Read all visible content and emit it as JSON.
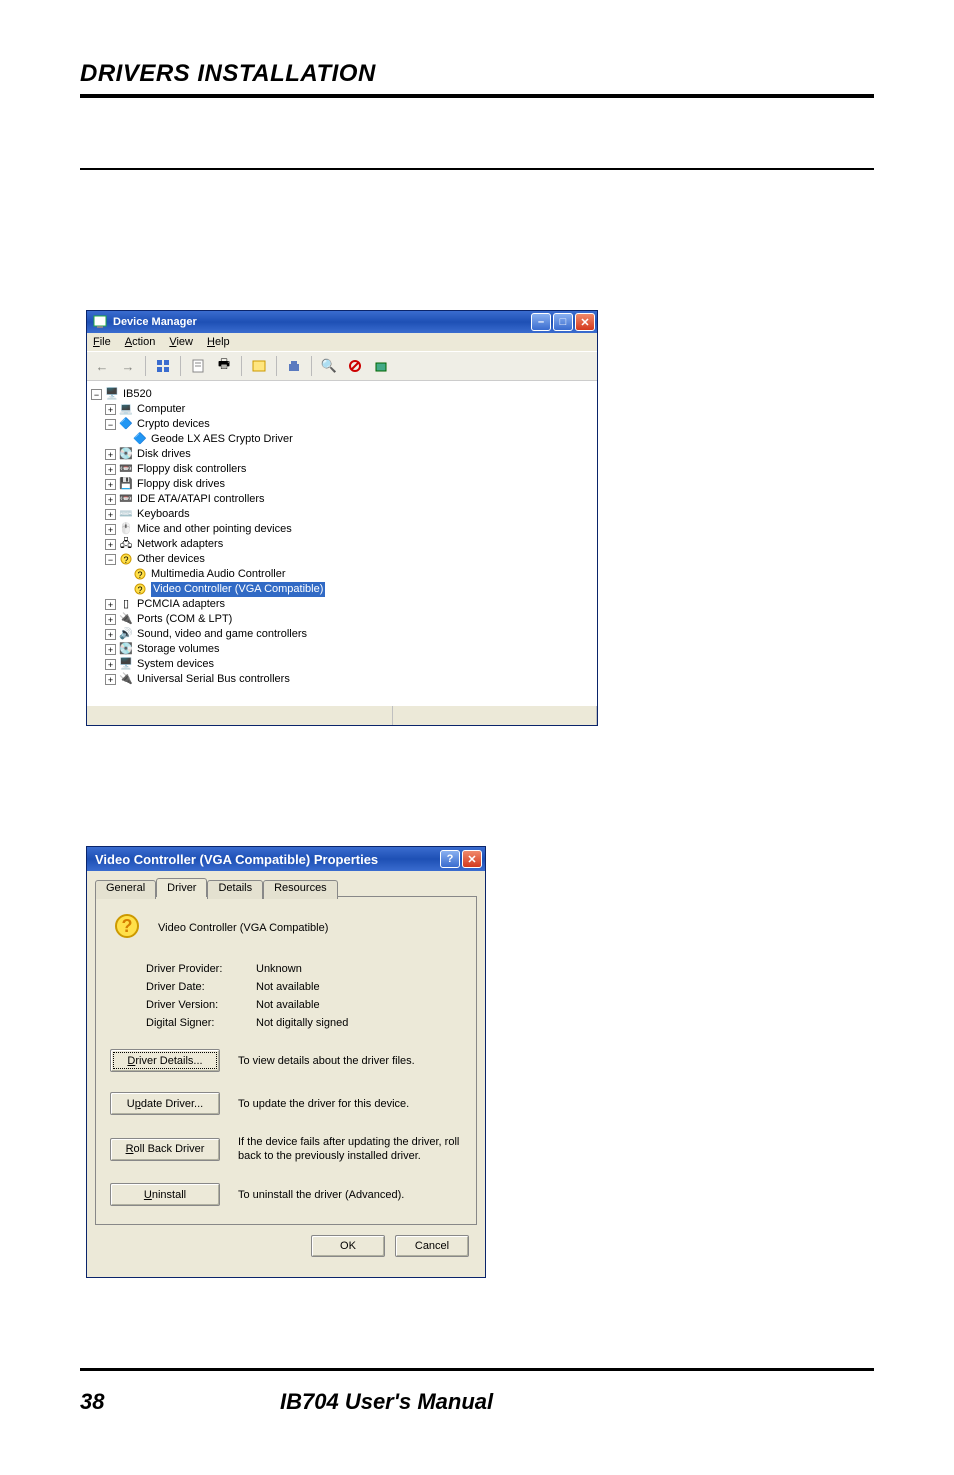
{
  "page": {
    "header": "DRIVERS INSTALLATION",
    "number": "38",
    "footer": "IB704 User's Manual"
  },
  "dm": {
    "title": "Device Manager",
    "menu": {
      "file": "File",
      "action": "Action",
      "view": "View",
      "help": "Help"
    },
    "root": "IB520",
    "nodes": {
      "computer": "Computer",
      "crypto": "Crypto devices",
      "crypto_child": "Geode LX AES Crypto Driver",
      "disk": "Disk drives",
      "floppy_ctrl": "Floppy disk controllers",
      "floppy": "Floppy disk drives",
      "ide": "IDE ATA/ATAPI controllers",
      "keyboards": "Keyboards",
      "mice": "Mice and other pointing devices",
      "network": "Network adapters",
      "other": "Other devices",
      "other_audio": "Multimedia Audio Controller",
      "other_video": "Video Controller (VGA Compatible)",
      "pcmcia": "PCMCIA adapters",
      "ports": "Ports (COM & LPT)",
      "sound": "Sound, video and game controllers",
      "storage": "Storage volumes",
      "system": "System devices",
      "usb": "Universal Serial Bus controllers"
    }
  },
  "prop": {
    "title": "Video Controller (VGA Compatible) Properties",
    "tabs": {
      "general": "General",
      "driver": "Driver",
      "details": "Details",
      "resources": "Resources"
    },
    "device_name": "Video Controller (VGA Compatible)",
    "rows": {
      "provider_l": "Driver Provider:",
      "provider_v": "Unknown",
      "date_l": "Driver Date:",
      "date_v": "Not available",
      "version_l": "Driver Version:",
      "version_v": "Not available",
      "signer_l": "Digital Signer:",
      "signer_v": "Not digitally signed"
    },
    "btns": {
      "details": "Driver Details...",
      "details_d": "To view details about the driver files.",
      "update": "Update Driver...",
      "update_d": "To update the driver for this device.",
      "rollback": "Roll Back Driver",
      "rollback_d": "If the device fails after updating the driver, roll back to the previously installed driver.",
      "uninstall": "Uninstall",
      "uninstall_d": "To uninstall the driver (Advanced)."
    },
    "ok": "OK",
    "cancel": "Cancel"
  }
}
